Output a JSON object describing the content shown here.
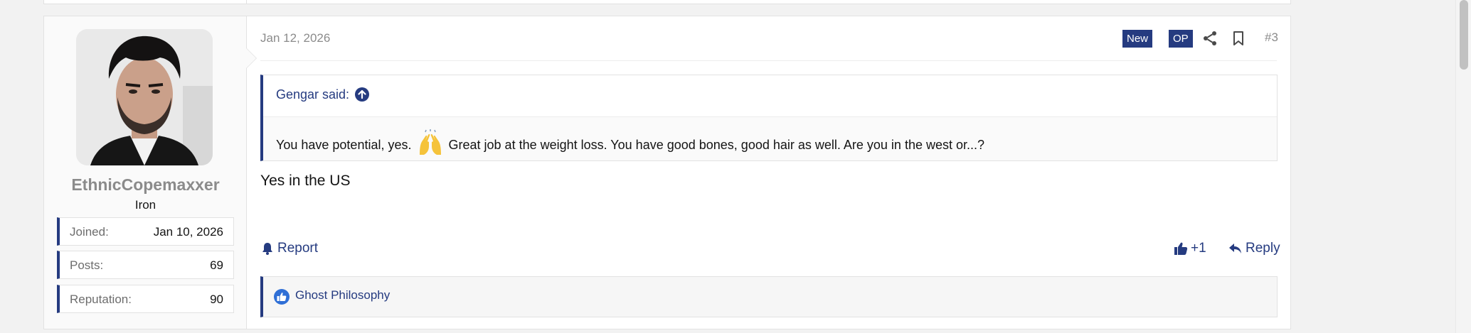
{
  "post": {
    "date": "Jan 12, 2026",
    "badges": {
      "new": "New",
      "op": "OP"
    },
    "number": "#3",
    "user": {
      "name": "EthnicCopemaxxer",
      "title": "Iron",
      "stats": [
        {
          "label": "Joined:",
          "value": "Jan 10, 2026"
        },
        {
          "label": "Posts:",
          "value": "69"
        },
        {
          "label": "Reputation:",
          "value": "90"
        }
      ]
    },
    "quote": {
      "author": "Gengar said:",
      "text_before": "You have potential, yes.",
      "text_after": "Great job at the weight loss. You have good bones, good hair as well. Are you in the west or...?"
    },
    "body": "Yes in the US",
    "actions": {
      "report": "Report",
      "like": "+1",
      "reply": "Reply"
    },
    "reactions": {
      "reactor": "Ghost Philosophy"
    }
  },
  "colors": {
    "accent": "#253b80",
    "muted": "#8b8b8b"
  },
  "icons": [
    "share-icon",
    "bookmark-icon",
    "arrow-up-circle-icon",
    "bell-icon",
    "thumbs-up-icon",
    "reply-icon",
    "raised-hands-emoji"
  ]
}
